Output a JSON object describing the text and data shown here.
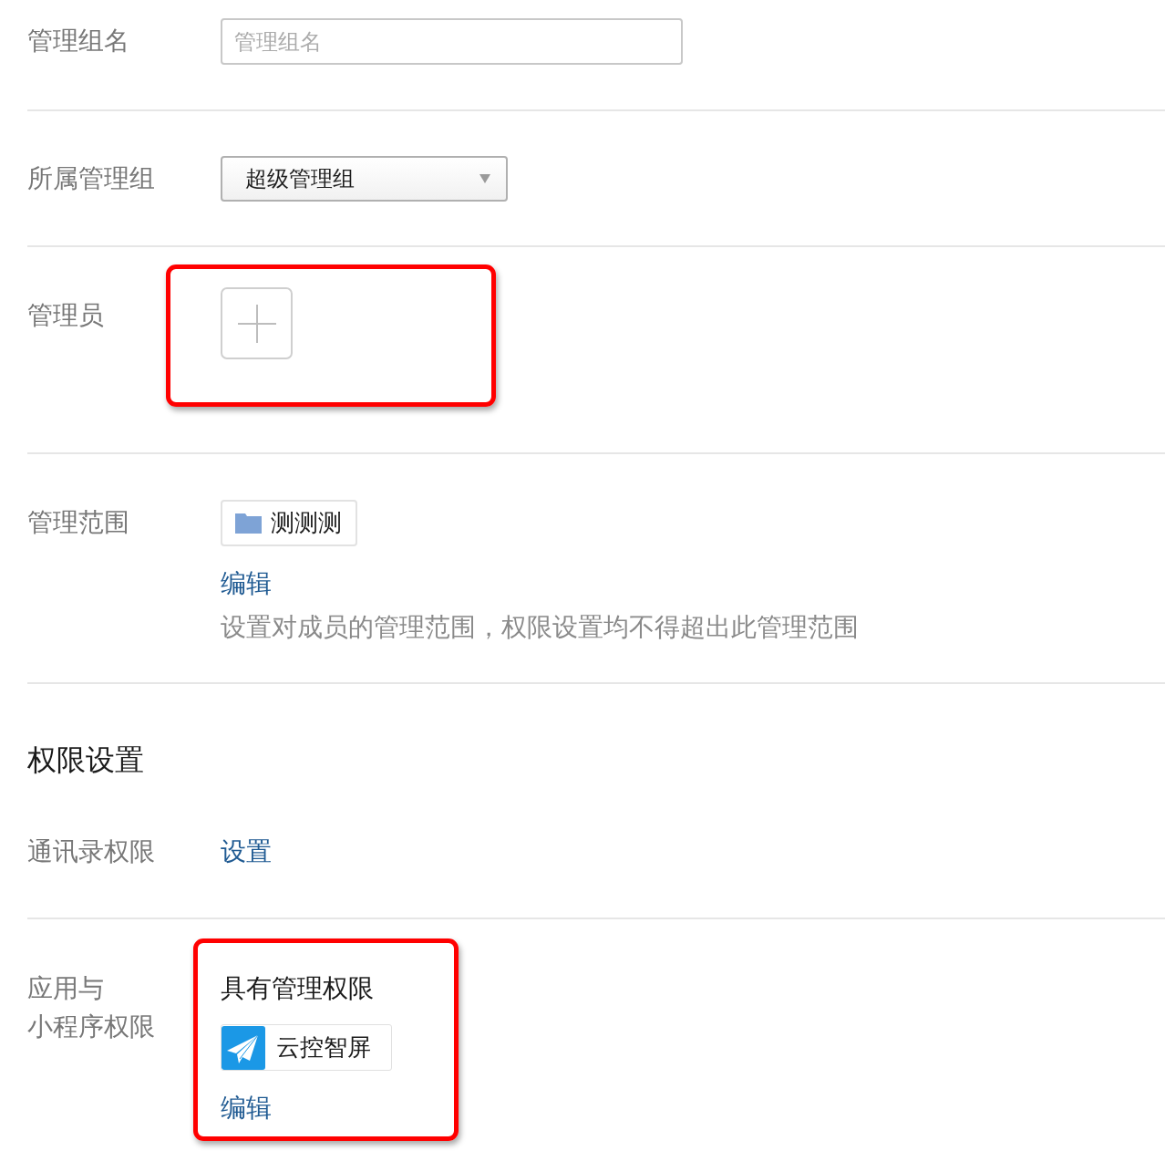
{
  "form": {
    "rows": [
      {
        "kind": "text",
        "label": "管理组名",
        "placeholder": "管理组名",
        "highlighted": false
      },
      {
        "kind": "select",
        "label": "所属管理组",
        "value": "超级管理组",
        "highlighted": false
      },
      {
        "kind": "members",
        "label": "管理员",
        "highlighted": true
      },
      {
        "kind": "scope",
        "label": "管理范围",
        "tags": [
          "测测测"
        ],
        "link": "编辑",
        "hint": "设置对成员的管理范围，权限设置均不得超出此管理范围",
        "highlighted": false
      }
    ]
  },
  "permissions": {
    "title": "权限设置",
    "rows": [
      {
        "kind": "link",
        "label": "通讯录权限",
        "link": "设置",
        "highlighted": false
      },
      {
        "kind": "apps",
        "label_lines": [
          "应用与",
          "小程序权限"
        ],
        "subtitle": "具有管理权限",
        "apps": [
          {
            "name": "云控智屏"
          }
        ],
        "link": "编辑",
        "highlighted": true
      }
    ]
  }
}
